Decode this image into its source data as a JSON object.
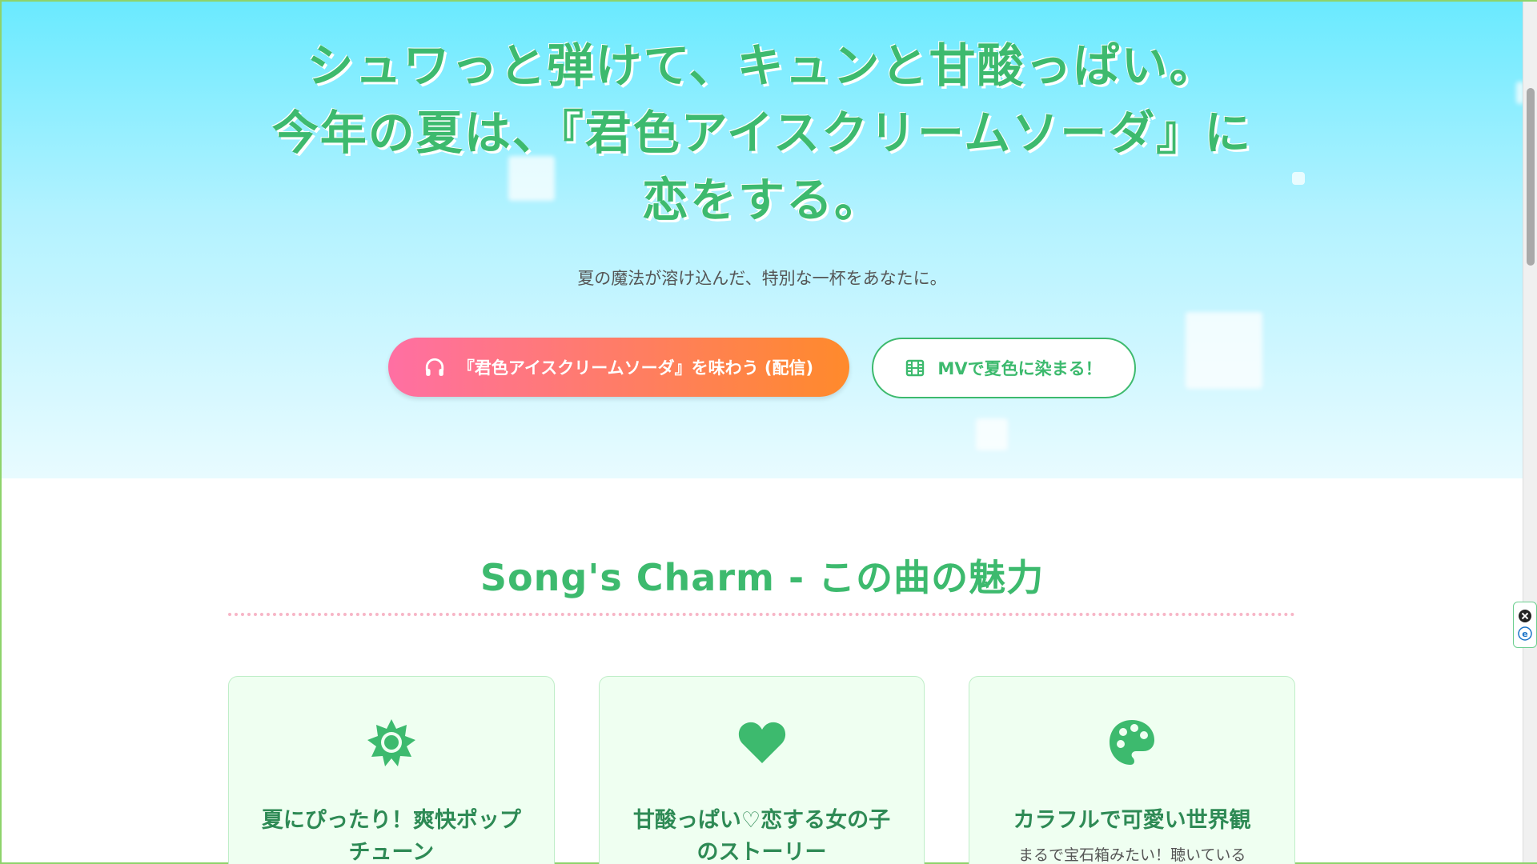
{
  "hero": {
    "headline_line1": "シュワっと弾けて、キュンと甘酸っぱい。",
    "headline_line2": "今年の夏は、『君色アイスクリームソーダ』に",
    "headline_line3": "恋をする。",
    "subline": "夏の魔法が溶け込んだ、特別な一杯をあなたに。",
    "primary_button": "『君色アイスクリームソーダ』を味わう (配信)",
    "secondary_button": "MVで夏色に染まる！"
  },
  "section": {
    "title": "Song's Charm - この曲の魅力",
    "cards": [
      {
        "icon": "sun-icon",
        "title": "夏にぴったり！爽快ポップチューン",
        "text": ""
      },
      {
        "icon": "heart-icon",
        "title": "甘酸っぱい♡恋する女の子のストーリー",
        "text": ""
      },
      {
        "icon": "palette-icon",
        "title": "カラフルで可愛い世界観",
        "text": "まるで宝石箱みたい！聴いている"
      }
    ]
  },
  "colors": {
    "accent_green": "#3dba6e",
    "gradient_pink": "#ff6fa3",
    "gradient_orange": "#ff8a2b",
    "sky": "#6aeaff",
    "dotted_pink": "#f7b5c6"
  },
  "side_widget": {
    "icons": [
      "close-icon",
      "edge-icon"
    ]
  }
}
